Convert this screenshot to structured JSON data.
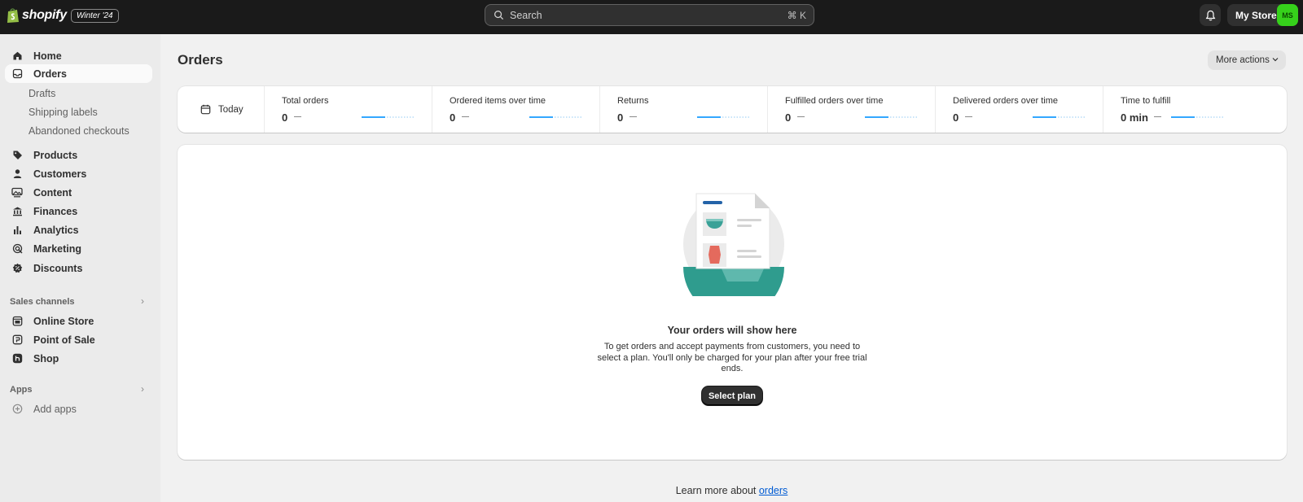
{
  "topbar": {
    "logo_text": "shopify",
    "version_badge": "Winter '24",
    "search_placeholder": "Search",
    "search_shortcut": "⌘ K",
    "store_name": "My Store",
    "avatar_initials": "MS"
  },
  "sidebar": {
    "items": [
      {
        "label": "Home",
        "icon": "home-icon"
      },
      {
        "label": "Orders",
        "icon": "inbox-icon",
        "active": true
      },
      {
        "label": "Drafts"
      },
      {
        "label": "Shipping labels"
      },
      {
        "label": "Abandoned checkouts"
      },
      {
        "label": "Products",
        "icon": "tag-icon"
      },
      {
        "label": "Customers",
        "icon": "person-icon"
      },
      {
        "label": "Content",
        "icon": "image-icon"
      },
      {
        "label": "Finances",
        "icon": "bank-icon"
      },
      {
        "label": "Analytics",
        "icon": "bar-chart-icon"
      },
      {
        "label": "Marketing",
        "icon": "target-icon"
      },
      {
        "label": "Discounts",
        "icon": "discount-icon"
      }
    ],
    "sales_channels_title": "Sales channels",
    "sales_channels": [
      {
        "label": "Online Store",
        "icon": "store-icon"
      },
      {
        "label": "Point of Sale",
        "icon": "pos-icon"
      },
      {
        "label": "Shop",
        "icon": "shop-icon"
      }
    ],
    "apps_title": "Apps",
    "add_apps": "Add apps"
  },
  "main": {
    "title": "Orders",
    "more_actions": "More actions",
    "date_range": "Today",
    "metrics": [
      {
        "title": "Total orders",
        "value": "0"
      },
      {
        "title": "Ordered items over time",
        "value": "0"
      },
      {
        "title": "Returns",
        "value": "0"
      },
      {
        "title": "Fulfilled orders over time",
        "value": "0"
      },
      {
        "title": "Delivered orders over time",
        "value": "0"
      },
      {
        "title": "Time to fulfill",
        "value": "0 min"
      }
    ],
    "empty_state": {
      "heading": "Your orders will show here",
      "body": "To get orders and accept payments from customers, you need to select a plan. You'll only be charged for your plan after your free trial ends.",
      "button": "Select plan"
    },
    "learn_more_prefix": "Learn more about",
    "learn_more_link": "orders"
  },
  "colors": {
    "topbar_bg": "#1a1a1a",
    "sidebar_bg": "#ebebeb",
    "page_bg": "#f1f1f1",
    "avatar": "#36d11b",
    "link": "#005bd3",
    "sparkline": "#33a7ff",
    "illustration_teal": "#2f9c8e"
  }
}
